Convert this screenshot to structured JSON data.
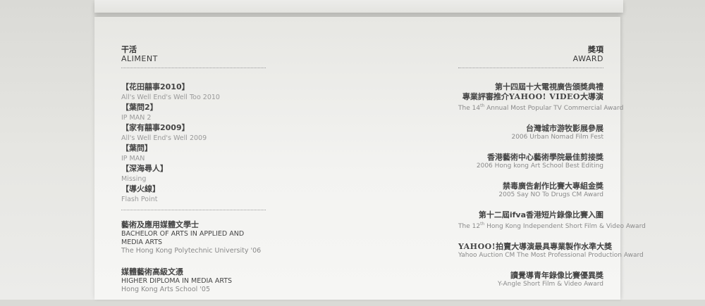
{
  "aliment": {
    "title_zh": "干活",
    "title_en": "ALIMENT",
    "films": [
      {
        "zh": "【花田囍事2010】",
        "en": "All's Well End's Well Too 2010"
      },
      {
        "zh": "【葉問2】",
        "en": "IP MAN 2"
      },
      {
        "zh": "【家有囍事2009】",
        "en": "All's Well End's Well 2009"
      },
      {
        "zh": "【葉問】",
        "en": "IP MAN"
      },
      {
        "zh": "【深海尋人】",
        "en": "Missing"
      },
      {
        "zh": "【導火線】",
        "en": "Flash Point"
      }
    ]
  },
  "education": [
    {
      "zh": "藝術及應用媒體文學士",
      "en": "BACHELOR OF ARTS IN APPLIED AND MEDIA ARTS",
      "school": "The Hong Kong Polytechnic University '06"
    },
    {
      "zh": "媒體藝術高級文憑",
      "en": "HIGHER DIPLOMA IN MEDIA ARTS",
      "school": "Hong Kong Arts School '05"
    }
  ],
  "award": {
    "title_zh": "獎項",
    "title_en": "AWARD",
    "a1": {
      "zh_line1": "第十四屆十大電視廣告頒獎典禮",
      "zh_line2_pre": "專業評審推介",
      "zh_line2_brand": "YAHOO! VIDEO",
      "zh_line2_post": "大導演",
      "en_pre": "The 14",
      "en_sup": "th",
      "en_post": " Annual Most Popular TV Commercial Award"
    },
    "a2": {
      "zh": "台灣城市游牧影展參展",
      "en": "2006 Urban Nomad Film Fest"
    },
    "a3": {
      "zh": "香港藝術中心藝術學院最佳剪接獎",
      "en": "2006 Hong kong Art School Best Editing"
    },
    "a4": {
      "zh": "禁毒廣告創作比賽大專組金獎",
      "en": "2005 Say NO To Drugs CM Award"
    },
    "a5": {
      "zh": "第十二屆ifva香港短片錄像比賽入圍",
      "en_pre": "The 12",
      "en_sup": "th",
      "en_post": " Hong Kong Independent Short Film & Video Award"
    },
    "a6": {
      "zh_brand": "YAHOO!",
      "zh_post": "拍賣大導演最具專業製作水準大獎",
      "en": "Yahoo Auction CM The Most Professional Production Award"
    },
    "a7": {
      "zh": "讀覺導青年錄像比賽優異獎",
      "en": "Y-Angle Short Film & Video Award"
    }
  }
}
